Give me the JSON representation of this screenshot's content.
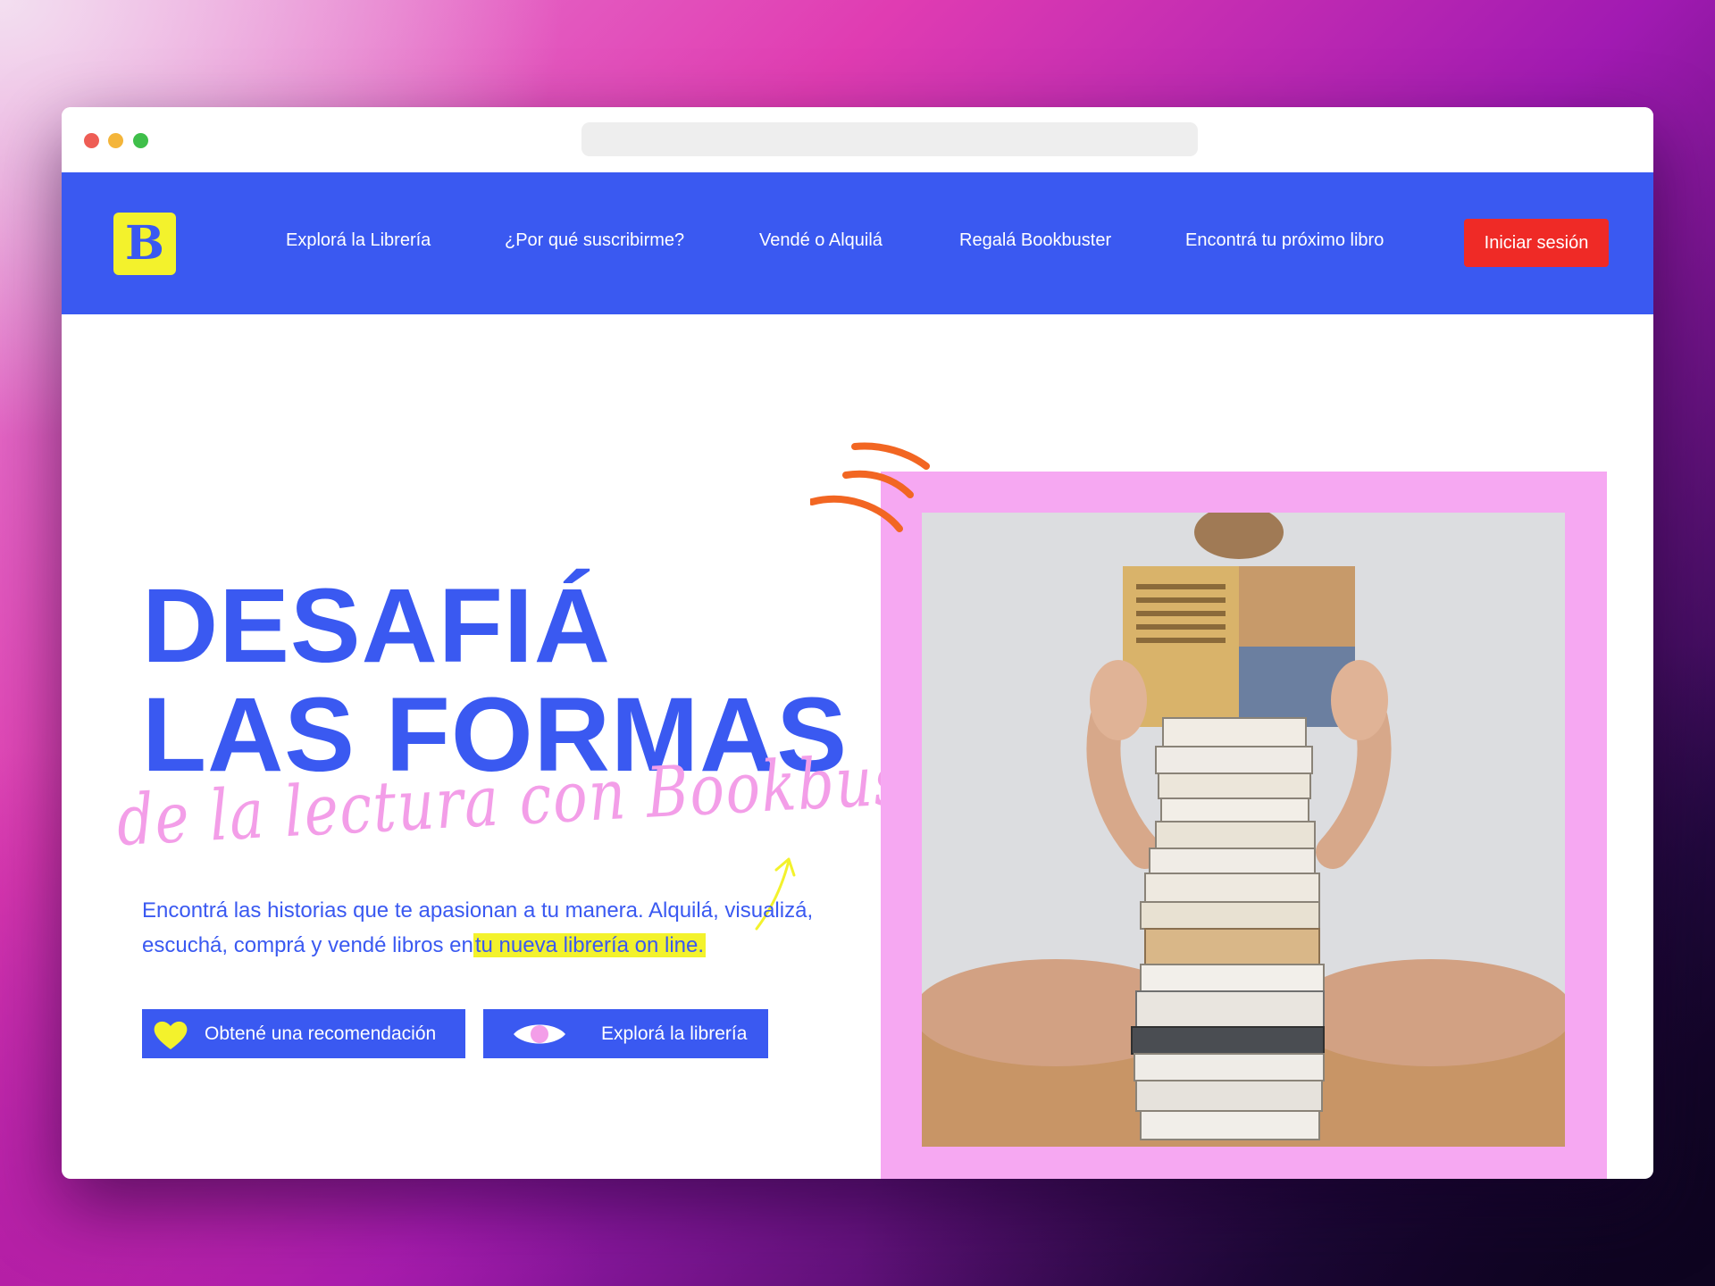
{
  "brand": {
    "logo_letter": "B"
  },
  "nav": {
    "items": [
      "Explorá la Librería",
      "¿Por qué suscribirme?",
      "Vendé o Alquilá",
      "Regalá Bookbuster",
      "Encontrá tu próximo libro"
    ],
    "login_label": "Iniciar sesión"
  },
  "hero": {
    "headline_line1": "DESAFIÁ",
    "headline_line2": "LAS FORMAS",
    "script_line": "de la lectura con Bookbuster.",
    "description_before": "Encontrá las historias que te apasionan a tu manera. Alquilá, visualizá, escuchá, comprá y vendé libros en",
    "description_highlight": "tu nueva librería on line."
  },
  "buttons": {
    "recommend_label": "Obtené una recomendación",
    "explore_label": "Explorá la librería"
  },
  "colors": {
    "brand_blue": "#3a59f1",
    "accent_yellow": "#f3f22c",
    "login_red": "#ef2a26",
    "script_pink": "#f39ee8",
    "frame_pink": "#f6a8f2",
    "scribble_orange": "#f26622"
  },
  "icons": {
    "recommend": "heart-icon",
    "explore": "eye-icon"
  }
}
